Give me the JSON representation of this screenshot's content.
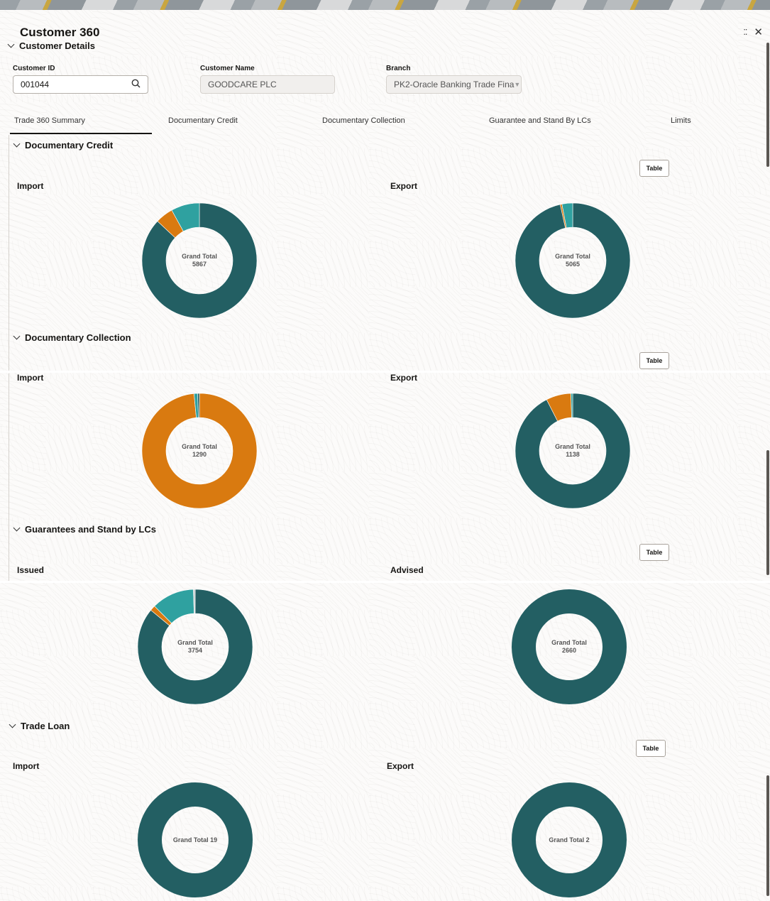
{
  "app": {
    "title": "Customer 360",
    "collapse_glyph": "⁚⁚",
    "close_glyph": "✕"
  },
  "customer_details": {
    "header": "Customer Details",
    "customer_id": {
      "label": "Customer ID",
      "value": "001044"
    },
    "customer_name": {
      "label": "Customer Name",
      "value": "GOODCARE PLC"
    },
    "branch": {
      "label": "Branch",
      "value": "PK2-Oracle Banking Trade Fina"
    }
  },
  "tabs": [
    {
      "label": "Trade 360 Summary",
      "selected": true
    },
    {
      "label": "Documentary Credit"
    },
    {
      "label": "Documentary Collection"
    },
    {
      "label": "Guarantee and Stand By LCs"
    },
    {
      "label": "Limits"
    }
  ],
  "colors": {
    "dark_teal": "#235f63",
    "orange": "#d97a10",
    "light_teal": "#2fa1a0"
  },
  "sections": {
    "documentary_credit": {
      "header": "Documentary Credit",
      "table_label": "Table",
      "left": {
        "label": "Import",
        "total_label": "Grand Total",
        "total": "5867"
      },
      "right": {
        "label": "Export",
        "total_label": "Grand Total",
        "total": "5065"
      }
    },
    "documentary_collection": {
      "header": "Documentary Collection",
      "table_label": "Table",
      "left": {
        "label": "Import",
        "total_label": "Grand Total",
        "total": "1290"
      },
      "right": {
        "label": "Export",
        "total_label": "Grand Total",
        "total": "1138"
      }
    },
    "guarantees": {
      "header": "Guarantees and Stand by LCs",
      "table_label": "Table",
      "left": {
        "label": "Issued",
        "total_label": "Grand Total",
        "total": "3754"
      },
      "right": {
        "label": "Advised",
        "total_label": "Grand Total",
        "total": "2660"
      }
    },
    "trade_loan": {
      "header": "Trade Loan",
      "table_label": "Table",
      "left": {
        "label": "Import",
        "total_label": "Grand Total 19"
      },
      "right": {
        "label": "Export",
        "total_label": "Grand Total 2"
      }
    }
  },
  "chart_data": [
    {
      "id": "dc-import",
      "type": "pie",
      "title": "Import",
      "center": "Grand Total 5867",
      "slices": [
        {
          "color": "#235f63",
          "value": 87
        },
        {
          "color": "#d97a10",
          "value": 5
        },
        {
          "color": "#2fa1a0",
          "value": 8
        }
      ]
    },
    {
      "id": "dc-export",
      "type": "pie",
      "title": "Export",
      "center": "Grand Total 5065",
      "slices": [
        {
          "color": "#235f63",
          "value": 96.5
        },
        {
          "color": "#d97a10",
          "value": 0.5
        },
        {
          "color": "#2fa1a0",
          "value": 3
        }
      ]
    },
    {
      "id": "dcol-import",
      "type": "pie",
      "title": "Import",
      "center": "Grand Total 1290",
      "slices": [
        {
          "color": "#d97a10",
          "value": 98.5
        },
        {
          "color": "#2fa1a0",
          "value": 1
        },
        {
          "color": "#235f63",
          "value": 0.5
        }
      ]
    },
    {
      "id": "dcol-export",
      "type": "pie",
      "title": "Export",
      "center": "Grand Total 1138",
      "slices": [
        {
          "color": "#235f63",
          "value": 92.5
        },
        {
          "color": "#d97a10",
          "value": 7
        },
        {
          "color": "#2fa1a0",
          "value": 0.5
        }
      ]
    },
    {
      "id": "g-issued",
      "type": "pie",
      "title": "Issued",
      "center": "Grand Total 3754",
      "slices": [
        {
          "color": "#235f63",
          "value": 86
        },
        {
          "color": "#d97a10",
          "value": 1.5
        },
        {
          "color": "#2fa1a0",
          "value": 12
        },
        {
          "color": "#c9d0d1",
          "value": 0.5
        }
      ]
    },
    {
      "id": "g-advised",
      "type": "pie",
      "title": "Advised",
      "center": "Grand Total 2660",
      "slices": [
        {
          "color": "#235f63",
          "value": 100
        }
      ]
    },
    {
      "id": "tl-import",
      "type": "pie",
      "title": "Import",
      "center": "Grand Total 19",
      "slices": [
        {
          "color": "#235f63",
          "value": 100
        }
      ]
    },
    {
      "id": "tl-export",
      "type": "pie",
      "title": "Export",
      "center": "Grand Total 2",
      "slices": [
        {
          "color": "#235f63",
          "value": 100
        }
      ]
    }
  ]
}
